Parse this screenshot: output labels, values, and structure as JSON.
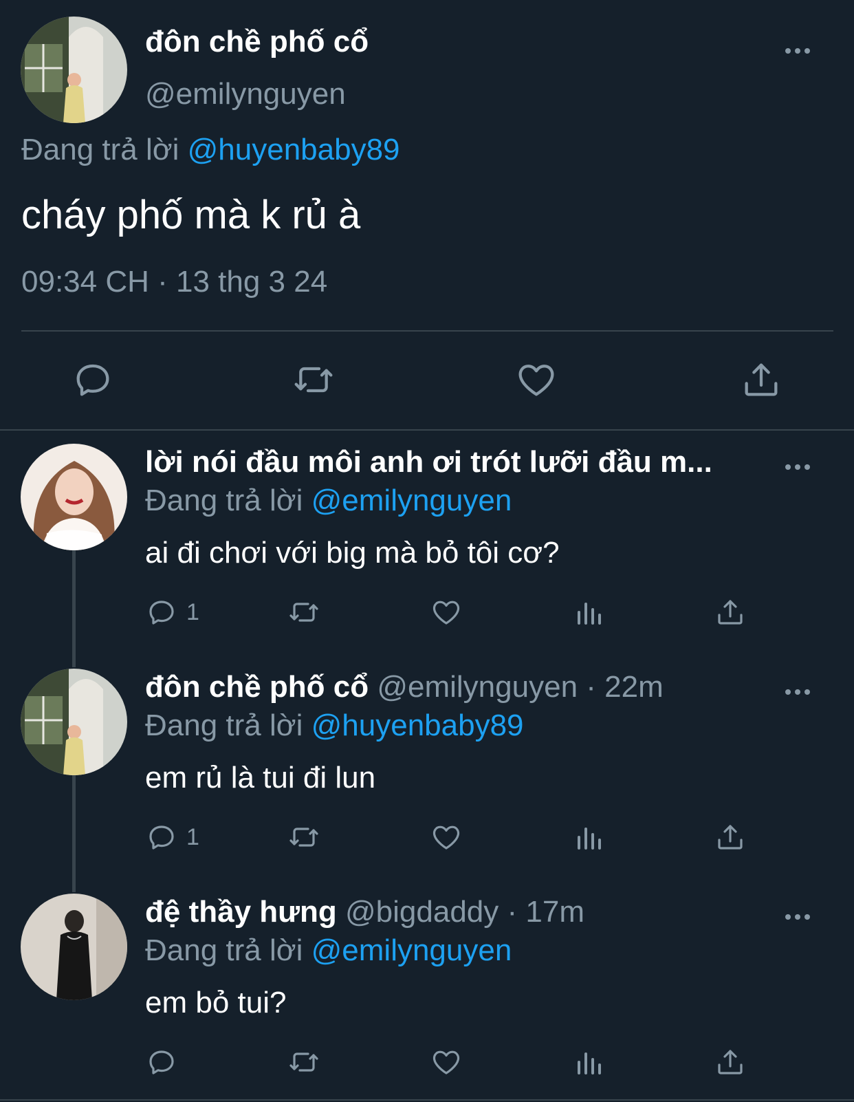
{
  "main_tweet": {
    "display_name": "đôn chề phố cổ",
    "handle": "@emilynguyen",
    "replying_prefix": "Đang trả lời",
    "replying_to": "@huyenbaby89",
    "text": "cháy phố mà k rủ à",
    "timestamp": "09:34 CH · 13 thg 3 24",
    "actions": [
      "reply-icon",
      "retweet-icon",
      "like-icon",
      "share-icon"
    ]
  },
  "replies": [
    {
      "display_name": "lời nói đầu môi anh ơi trót lưỡi đầu m...",
      "handle": "",
      "time": "",
      "replying_prefix": "Đang trả lời",
      "replying_to": "@emilynguyen",
      "text": "ai đi chơi với big mà bỏ tôi cơ?",
      "reply_count": "1",
      "avatar_colors": [
        "#b8896f",
        "#f0e6df"
      ]
    },
    {
      "display_name": "đôn chề phố cổ",
      "handle": "@emilynguyen",
      "time": "· 22m",
      "replying_prefix": "Đang trả lời",
      "replying_to": "@huyenbaby89",
      "text": "em rủ là tui đi lun",
      "reply_count": "1",
      "avatar_colors": [
        "#cfd2cc",
        "#5a6a4e"
      ]
    },
    {
      "display_name": "đệ thầy hưng",
      "handle": "@bigdaddy",
      "time": "· 17m",
      "replying_prefix": "Đang trả lời",
      "replying_to": "@emilynguyen",
      "text": "em bỏ tui?",
      "reply_count": "",
      "avatar_colors": [
        "#d7d1c9",
        "#1b1b1b"
      ]
    }
  ],
  "colors": {
    "background": "#15202b",
    "secondary_text": "#8899a6",
    "mention": "#1da1f2",
    "divider": "#38444d"
  }
}
